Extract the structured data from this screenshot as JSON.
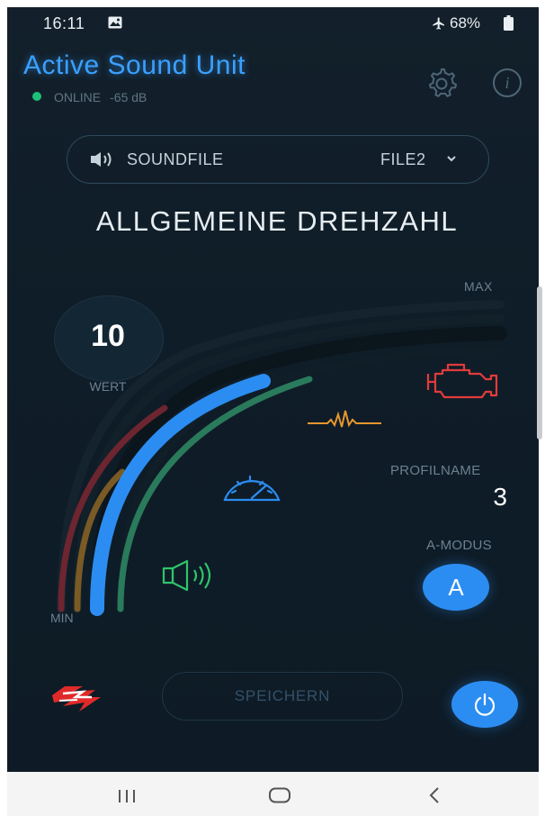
{
  "status_bar": {
    "time": "16:11",
    "battery": "68%"
  },
  "header": {
    "title": "Active Sound Unit",
    "status": "ONLINE",
    "signal": "-65 dB"
  },
  "soundfile": {
    "label": "SOUNDFILE",
    "value": "FILE2"
  },
  "heading": "ALLGEMEINE DREHZAHL",
  "gauge": {
    "max_label": "MAX",
    "min_label": "MIN",
    "value": 10,
    "value_label": "WERT"
  },
  "profile": {
    "label": "PROFILNAME",
    "value": "3"
  },
  "mode": {
    "label": "A-MODUS",
    "button_label": "A"
  },
  "actions": {
    "save_label": "SPEICHERN"
  },
  "colors": {
    "accent": "#2b8df2",
    "title": "#3aa0ff",
    "online": "#1fbf7a",
    "engine": "#e23b3b",
    "wave": "#e8962e",
    "speaker": "#2ec46a"
  },
  "icons": [
    "gallery-icon",
    "airplane-icon",
    "battery-icon",
    "gear-icon",
    "info-icon",
    "speaker-icon",
    "chevron-down-icon",
    "engine-icon",
    "waveform-icon",
    "speedometer-icon",
    "speaker-sound-icon",
    "brand-logo-icon",
    "power-icon",
    "recents-icon",
    "home-icon",
    "back-icon"
  ]
}
